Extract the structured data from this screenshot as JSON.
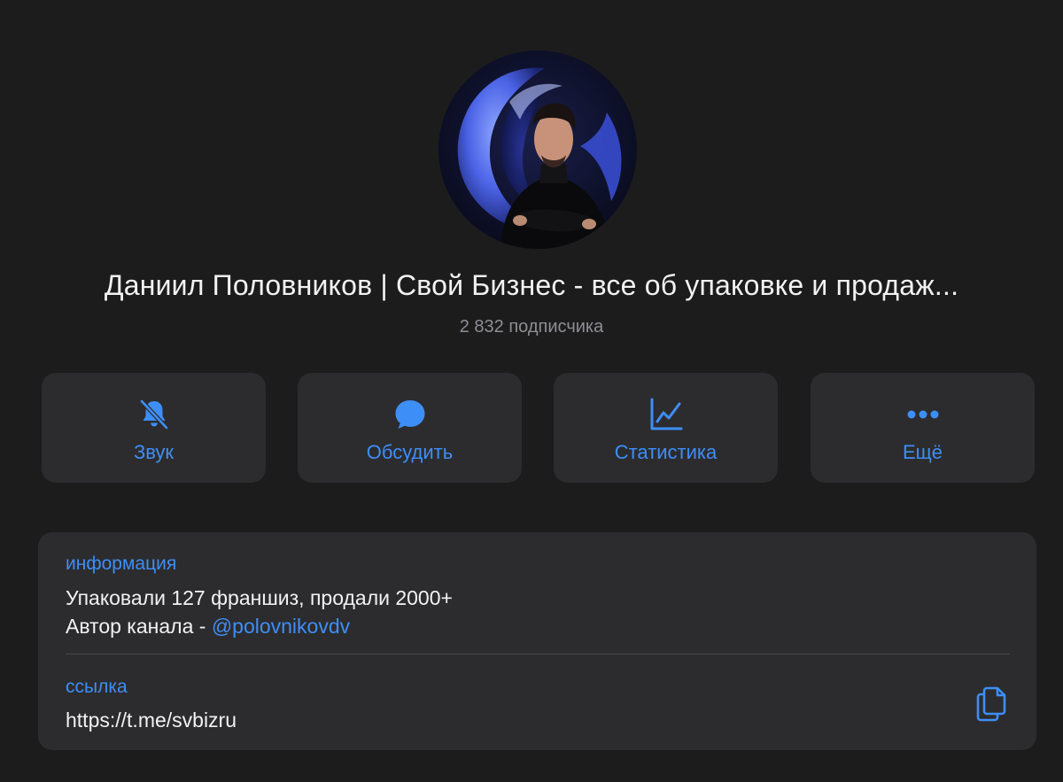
{
  "channel": {
    "title": "Даниил Половников | Свой Бизнес - все об упаковке и продаж...",
    "subscribers": "2 832 подписчика"
  },
  "actions": [
    {
      "label": "Звук",
      "icon": "bell-slash-icon"
    },
    {
      "label": "Обсудить",
      "icon": "chat-bubble-icon"
    },
    {
      "label": "Статистика",
      "icon": "line-chart-icon"
    },
    {
      "label": "Ещё",
      "icon": "ellipsis-icon"
    }
  ],
  "info": {
    "label": "информация",
    "line1": "Упаковали 127 франшиз, продали 2000+",
    "line2_prefix": "Автор канала - ",
    "mention": "@polovnikovdv"
  },
  "link": {
    "label": "ссылка",
    "url": "https://t.me/svbizru",
    "copy_icon": "copy-icon"
  },
  "colors": {
    "background": "#1c1c1d",
    "card": "#2c2c2e",
    "accent": "#3e8ef7",
    "secondary_text": "#8e8e93"
  }
}
